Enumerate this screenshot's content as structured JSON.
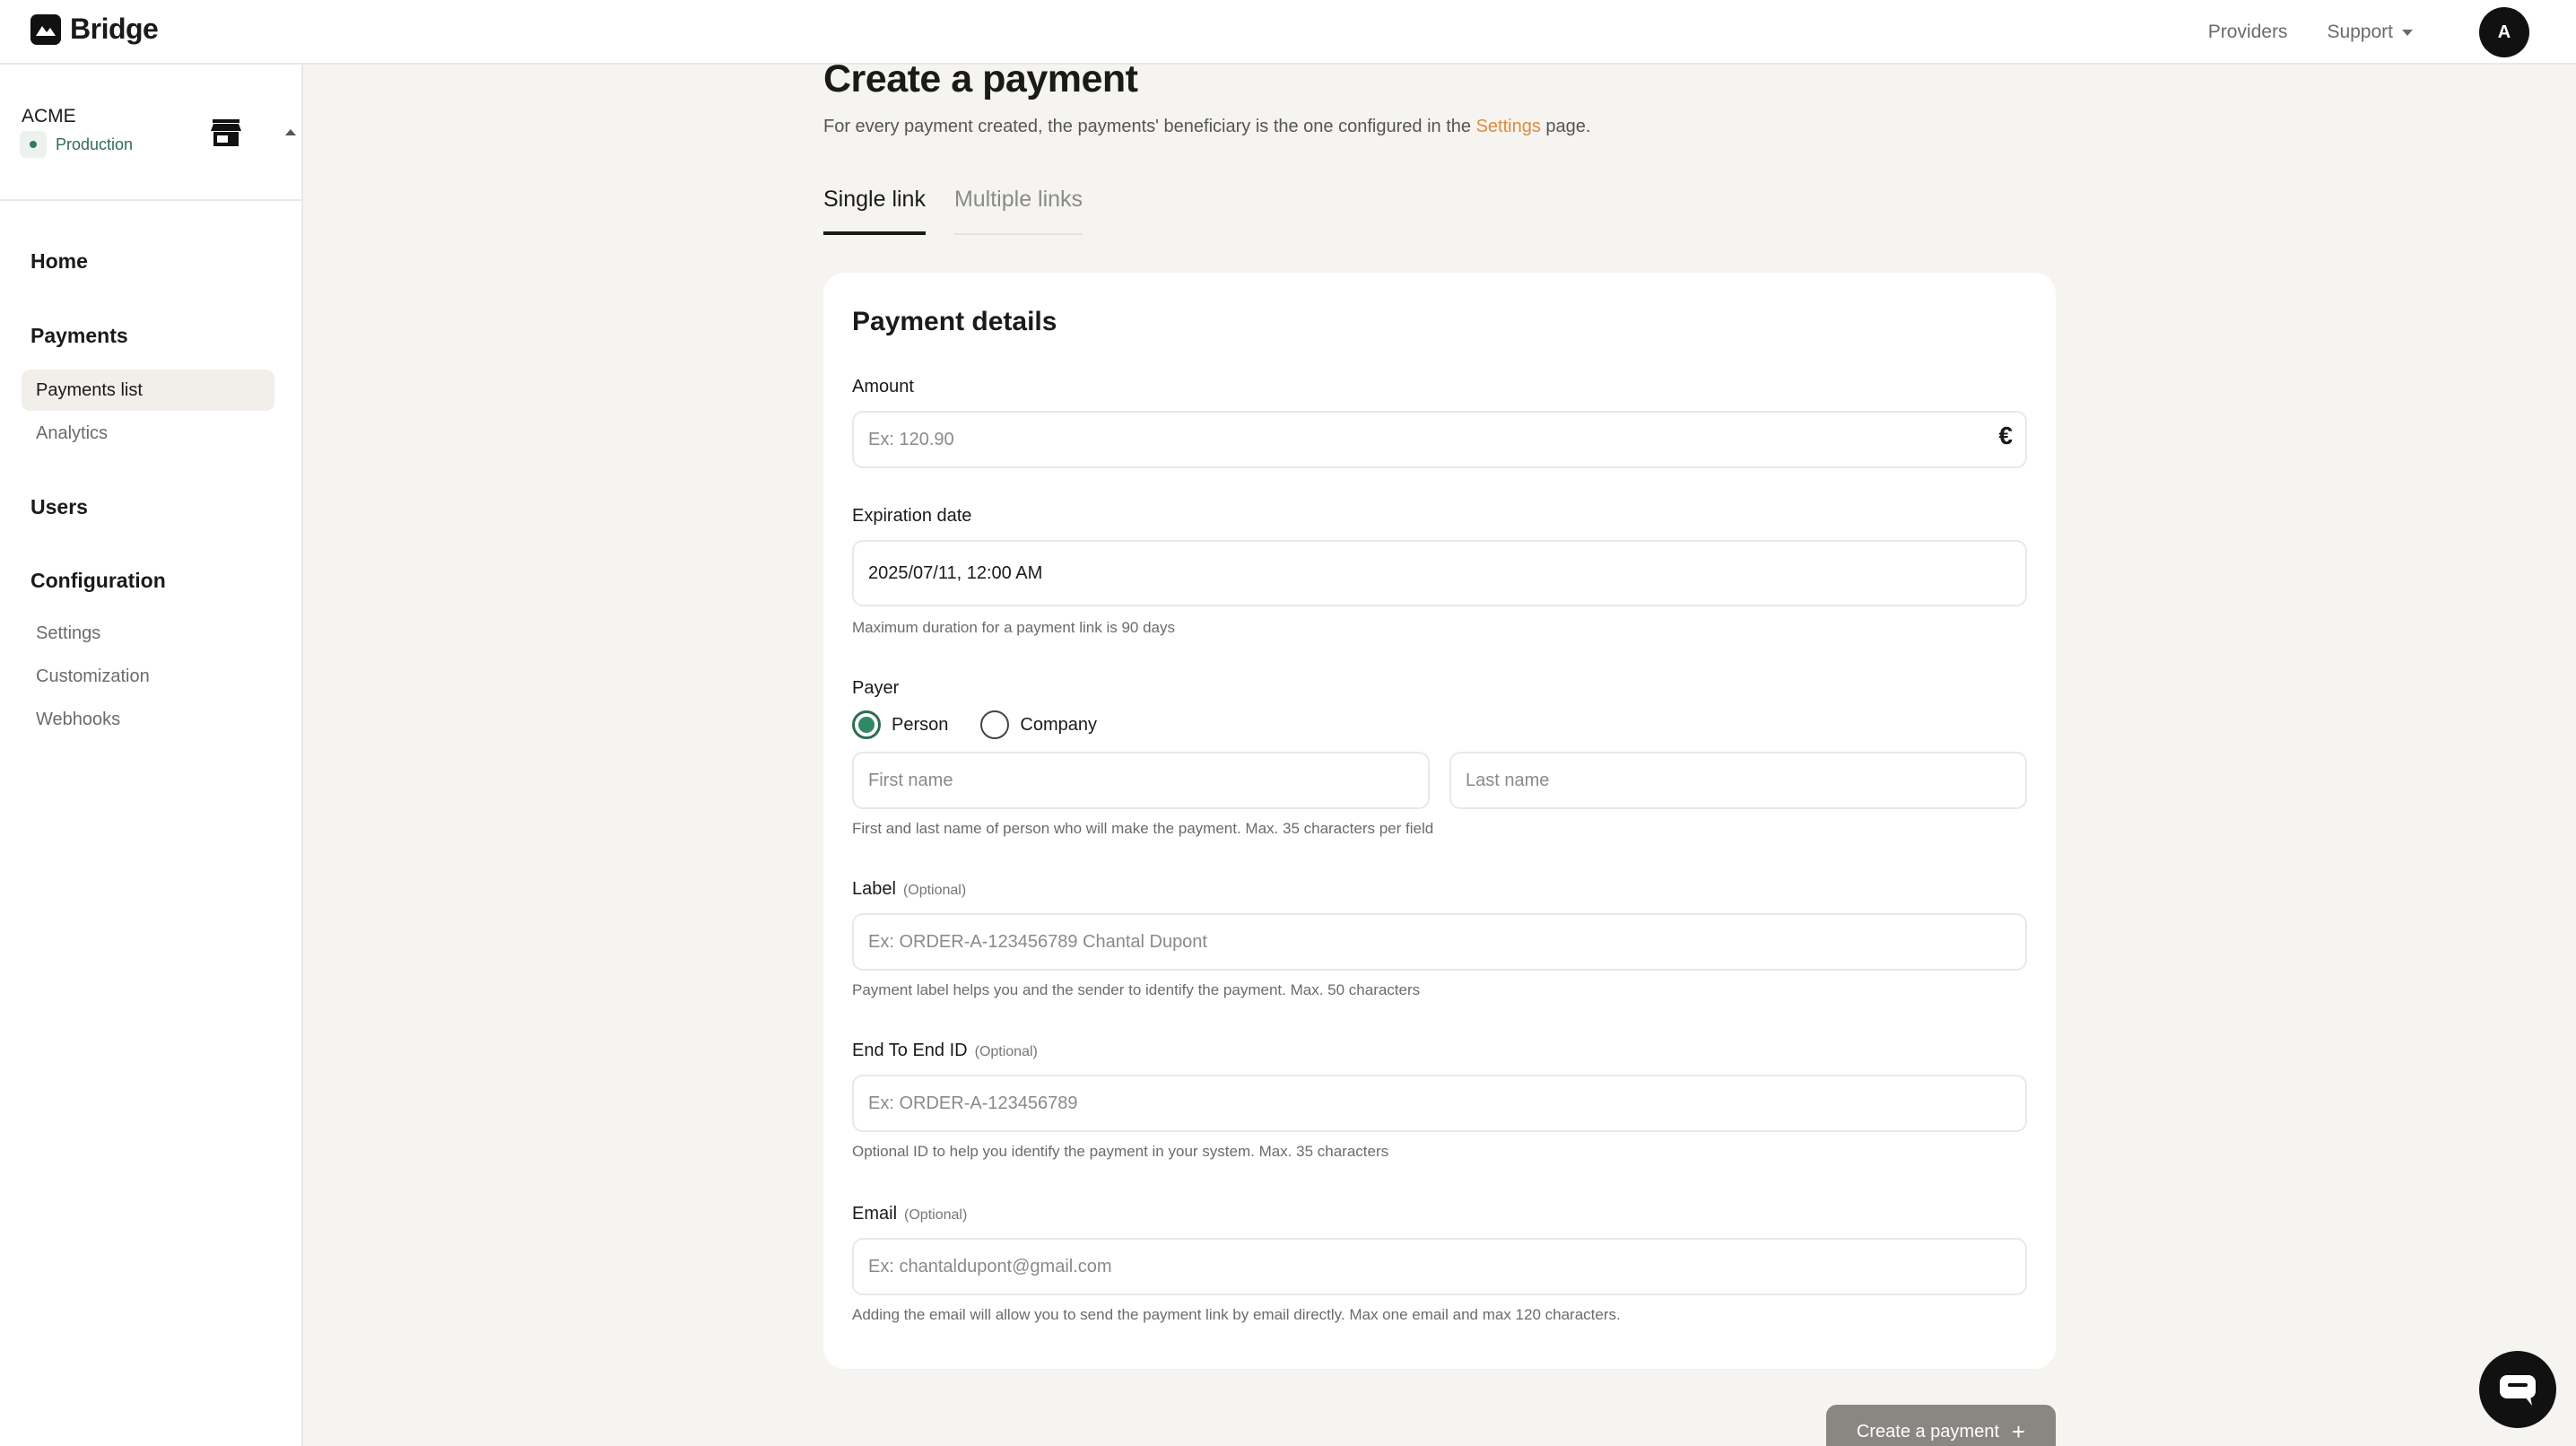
{
  "app": {
    "logo_text": "Bridge"
  },
  "header": {
    "providers_label": "Providers",
    "support_label": "Support",
    "avatar_initial": "A"
  },
  "sidebar": {
    "org_name": "ACME",
    "environment": "Production",
    "sections": {
      "home": "Home",
      "payments": "Payments",
      "users": "Users",
      "configuration": "Configuration"
    },
    "payments_items": [
      "Payments list",
      "Analytics"
    ],
    "configuration_items": [
      "Settings",
      "Customization",
      "Webhooks"
    ]
  },
  "page": {
    "title": "Create a payment",
    "subtitle_before": "For every payment created, the payments' beneficiary is the one configured in the ",
    "subtitle_link": "Settings",
    "subtitle_after": " page.",
    "tabs": [
      "Single link",
      "Multiple links"
    ],
    "active_tab": "Single link"
  },
  "form": {
    "card_title": "Payment details",
    "amount": {
      "label": "Amount",
      "placeholder": "Ex: 120.90",
      "currency_symbol": "€"
    },
    "expiration": {
      "label": "Expiration date",
      "value": "2025/07/11, 12:00 AM",
      "help": "Maximum duration for a payment link is 90 days"
    },
    "payer": {
      "label": "Payer",
      "options": [
        "Person",
        "Company"
      ],
      "selected": "Person",
      "first_name_placeholder": "First name",
      "last_name_placeholder": "Last name",
      "help": "First and last name of person who will make the payment. Max. 35 characters per field"
    },
    "payment_label": {
      "label": "Label",
      "optional": "(Optional)",
      "placeholder": "Ex: ORDER-A-123456789 Chantal Dupont",
      "help": "Payment label helps you and the sender to identify the payment. Max. 50 characters"
    },
    "end_to_end": {
      "label": "End To End ID",
      "optional": "(Optional)",
      "placeholder": "Ex: ORDER-A-123456789",
      "help": "Optional ID to help you identify the payment in your system. Max. 35 characters"
    },
    "email": {
      "label": "Email",
      "optional": "(Optional)",
      "placeholder": "Ex: chantaldupont@gmail.com",
      "help": "Adding the email will allow you to send the payment link by email directly. Max one email and max 120 characters."
    },
    "submit_label": "Create a payment"
  },
  "colors": {
    "accent_link": "#e08a3c",
    "production_green": "#2e6d52",
    "button_disabled": "#8a8783"
  },
  "icons": [
    "logo-icon",
    "store-icon",
    "caret-icon",
    "euro-icon",
    "plus-icon",
    "chat-icon"
  ]
}
